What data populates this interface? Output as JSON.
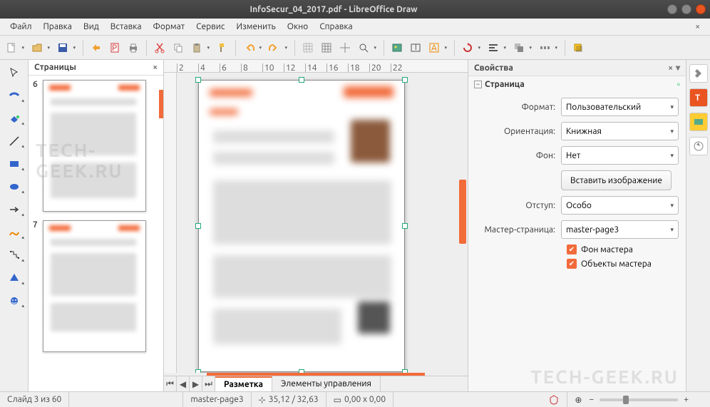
{
  "window": {
    "title": "InfoSecur_04_2017.pdf - LibreOffice Draw"
  },
  "menu": {
    "file": "Файл",
    "edit": "Правка",
    "view": "Вид",
    "insert": "Вставка",
    "format": "Формат",
    "service": "Сервис",
    "modify": "Изменить",
    "window": "Окно",
    "help": "Справка"
  },
  "panels": {
    "pages_title": "Страницы",
    "props_title": "Свойства",
    "section_page": "Страница"
  },
  "thumbs": {
    "n6": "6",
    "n7": "7"
  },
  "ruler": {
    "t2": "2",
    "t4": "4",
    "t6": "6",
    "t8": "8",
    "t10": "10",
    "t12": "12",
    "t14": "14",
    "t16": "16",
    "t18": "18",
    "t20": "20",
    "t22": "22"
  },
  "tabs": {
    "layout": "Разметка",
    "controls": "Элементы управления"
  },
  "props": {
    "format_label": "Формат:",
    "format_value": "Пользовательский",
    "orient_label": "Ориентация:",
    "orient_value": "Книжная",
    "bg_label": "Фон:",
    "bg_value": "Нет",
    "insert_img": "Вставить изображение",
    "margin_label": "Отступ:",
    "margin_value": "Особо",
    "master_label": "Мастер-страница:",
    "master_value": "master-page3",
    "chk_master_bg": "Фон мастера",
    "chk_master_obj": "Объекты мастера"
  },
  "status": {
    "slide": "Слайд 3 из 60",
    "master": "master-page3",
    "cursor": "35,12 / 32,63",
    "size": "0,00 x 0,00"
  },
  "watermark": {
    "w1": "TECH-GEEK.RU",
    "w2": "TECH-GEEK.RU"
  }
}
